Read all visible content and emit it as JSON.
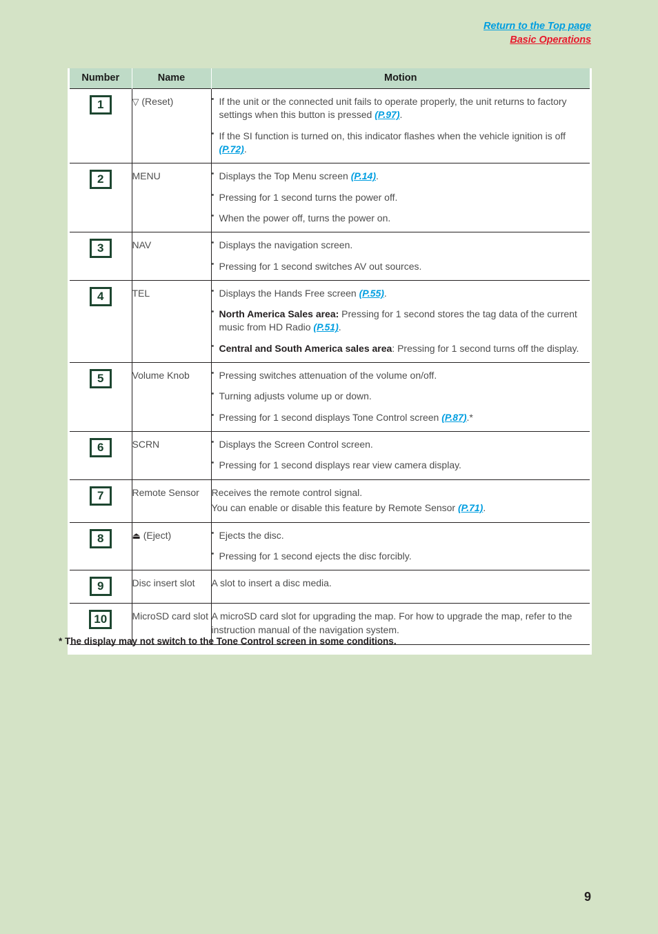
{
  "header": {
    "return_link": "Return to the Top page",
    "section_link": "Basic Operations"
  },
  "table": {
    "columns": [
      "Number",
      "Name",
      "Motion"
    ],
    "rows": [
      {
        "number": "1",
        "name_symbol": "▽",
        "name": "(Reset)",
        "items": [
          {
            "parts": [
              {
                "t": "If the unit or the connected unit fails to operate properly, the unit returns to factory settings when this button is pressed "
              },
              {
                "t": "(P.97)",
                "k": "ref"
              },
              {
                "t": "."
              }
            ]
          },
          {
            "parts": [
              {
                "t": "If the SI function is turned on, this indicator flashes when the vehicle ignition is off "
              },
              {
                "t": "(P.72)",
                "k": "ref"
              },
              {
                "t": "."
              }
            ]
          }
        ]
      },
      {
        "number": "2",
        "name": "MENU",
        "items": [
          {
            "parts": [
              {
                "t": "Displays the Top Menu screen "
              },
              {
                "t": "(P.14)",
                "k": "ref"
              },
              {
                "t": "."
              }
            ]
          },
          {
            "parts": [
              {
                "t": "Pressing for 1 second turns the power off."
              }
            ]
          },
          {
            "parts": [
              {
                "t": "When the power off, turns the power on."
              }
            ]
          }
        ]
      },
      {
        "number": "3",
        "name": "NAV",
        "items": [
          {
            "parts": [
              {
                "t": "Displays the navigation screen."
              }
            ]
          },
          {
            "parts": [
              {
                "t": "Pressing for 1 second switches AV out sources."
              }
            ]
          }
        ]
      },
      {
        "number": "4",
        "name": "TEL",
        "items": [
          {
            "parts": [
              {
                "t": "Displays the Hands Free screen "
              },
              {
                "t": "(P.55)",
                "k": "ref"
              },
              {
                "t": "."
              }
            ]
          },
          {
            "parts": [
              {
                "t": "North America Sales area:",
                "k": "bold"
              },
              {
                "t": " Pressing for 1 second stores the tag data of the current music from HD Radio "
              },
              {
                "t": "(P.51)",
                "k": "ref"
              },
              {
                "t": "."
              }
            ]
          },
          {
            "parts": [
              {
                "t": "Central and South America sales area",
                "k": "bold"
              },
              {
                "t": ": Pressing for 1 second turns off the display."
              }
            ]
          }
        ]
      },
      {
        "number": "5",
        "name": "Volume Knob",
        "items": [
          {
            "parts": [
              {
                "t": "Pressing switches attenuation of the volume on/off."
              }
            ]
          },
          {
            "parts": [
              {
                "t": "Turning adjusts volume up or down."
              }
            ]
          },
          {
            "parts": [
              {
                "t": "Pressing for 1 second displays Tone Control screen "
              },
              {
                "t": "(P.87)",
                "k": "ref"
              },
              {
                "t": ".*"
              }
            ]
          }
        ]
      },
      {
        "number": "6",
        "name": "SCRN",
        "items": [
          {
            "parts": [
              {
                "t": "Displays the Screen Control screen."
              }
            ]
          },
          {
            "parts": [
              {
                "t": "Pressing for 1 second displays rear view camera display."
              }
            ]
          }
        ]
      },
      {
        "number": "7",
        "name": "Remote Sensor",
        "style": "plain",
        "items": [
          {
            "parts": [
              {
                "t": "Receives the remote control signal."
              }
            ]
          },
          {
            "parts": [
              {
                "t": "You can enable or disable this feature by Remote Sensor "
              },
              {
                "t": "(P.71)",
                "k": "ref"
              },
              {
                "t": "."
              }
            ]
          }
        ]
      },
      {
        "number": "8",
        "name_symbol": "⏏",
        "name": "(Eject)",
        "items": [
          {
            "parts": [
              {
                "t": "Ejects the disc."
              }
            ]
          },
          {
            "parts": [
              {
                "t": "Pressing for 1 second ejects the disc forcibly."
              }
            ]
          }
        ]
      },
      {
        "number": "9",
        "name": "Disc insert slot",
        "style": "plain",
        "items": [
          {
            "parts": [
              {
                "t": "A slot to insert a disc media."
              }
            ]
          }
        ]
      },
      {
        "number": "10",
        "name": "MicroSD card slot",
        "style": "plain",
        "items": [
          {
            "parts": [
              {
                "t": "A microSD card slot for upgrading the map. For how to upgrade the map, refer to the instruction manual of the navigation system."
              }
            ]
          }
        ]
      }
    ]
  },
  "footnote": "* The display may not switch to the Tone Control screen in some conditions.",
  "page_number": "9",
  "colors": {
    "page_background": "#d4e3c6",
    "table_header": "#bfdbc7",
    "badge_green": "#1d4630",
    "link_blue": "#009ee0",
    "link_red": "#e8192c",
    "body_text": "#4d4d4d"
  }
}
